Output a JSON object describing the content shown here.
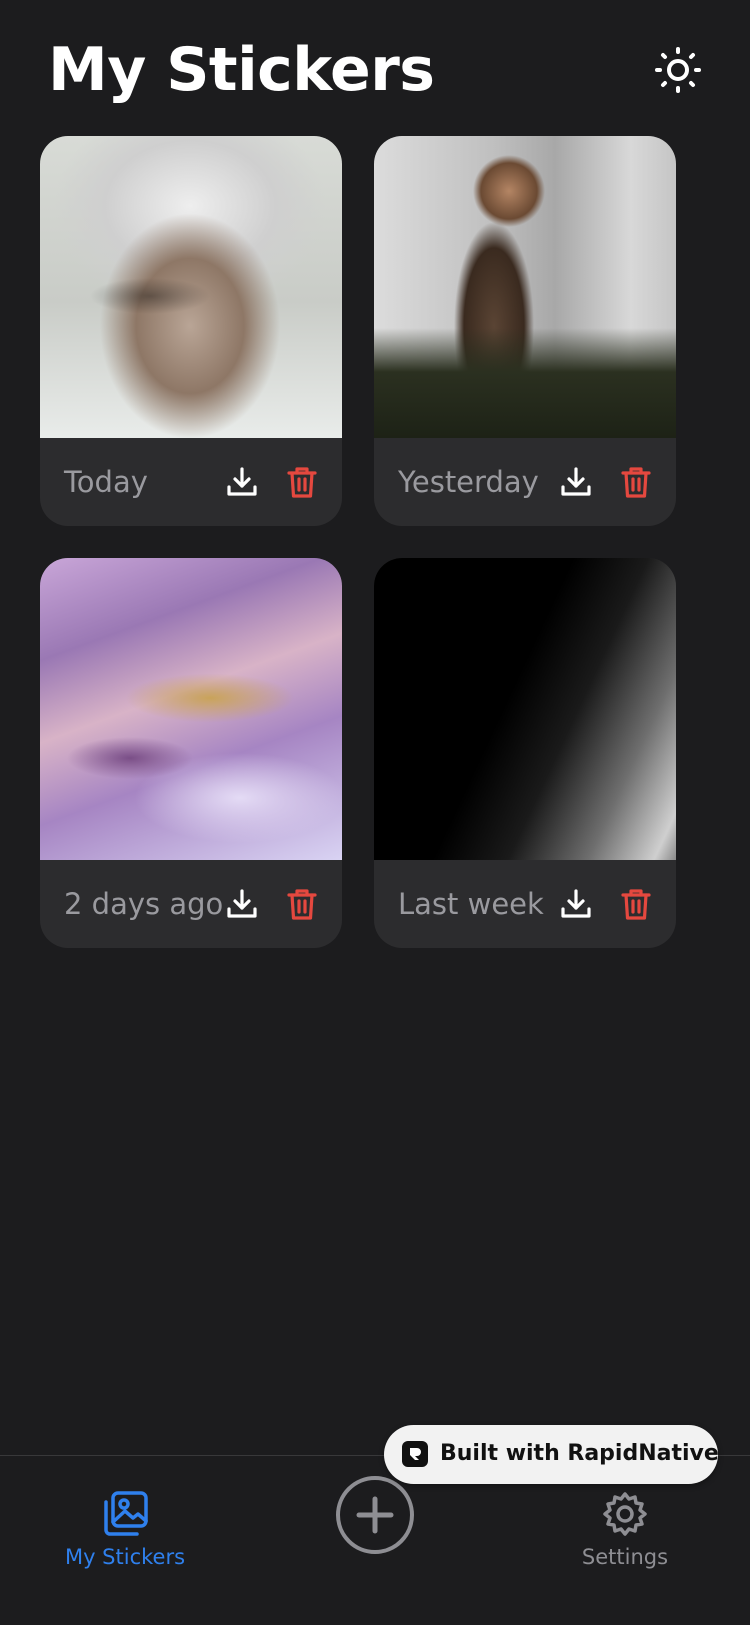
{
  "header": {
    "title": "My Stickers",
    "theme_toggle_icon": "sun-icon"
  },
  "stickers": [
    {
      "label": "Today",
      "image": "elderly-woman-glasses-portrait",
      "download_icon": "download-icon",
      "delete_icon": "trash-icon"
    },
    {
      "label": "Yesterday",
      "image": "woman-taking-selfie",
      "download_icon": "download-icon",
      "delete_icon": "trash-icon"
    },
    {
      "label": "2 days ago",
      "image": "purple-marble-fluid-art",
      "download_icon": "download-icon",
      "delete_icon": "trash-icon"
    },
    {
      "label": "Last week",
      "image": "dark-geometric-architecture",
      "download_icon": "download-icon",
      "delete_icon": "trash-icon"
    }
  ],
  "tabbar": {
    "tabs": [
      {
        "label": "My Stickers",
        "icon": "images-icon",
        "active": true
      },
      {
        "label": "Settings",
        "icon": "gear-icon",
        "active": false
      }
    ],
    "add_icon": "plus-circle-icon"
  },
  "badge": {
    "text": "Built with RapidNative",
    "logo": "rapidnative-logo"
  },
  "colors": {
    "background": "#1c1c1e",
    "card": "#2c2c2e",
    "accent": "#2f80ed",
    "danger": "#e5483f",
    "muted": "#9a9a9f"
  }
}
